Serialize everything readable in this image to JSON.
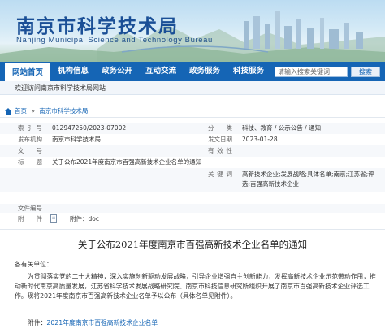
{
  "header": {
    "title_cn": "南京市科学技术局",
    "title_en": "Nanjing Municipal Science and Technology Bureau"
  },
  "nav": {
    "items": [
      "网站首页",
      "机构信息",
      "政务公开",
      "互动交流",
      "政务服务",
      "科技服务"
    ],
    "search_placeholder": "请输入搜索关键词",
    "search_button": "搜索"
  },
  "welcome": "欢迎访问南京市科学技术局网站",
  "breadcrumb": {
    "home": "首页",
    "sep": "»",
    "current": "南京市科学技术局"
  },
  "info": {
    "index_label": "索引号",
    "index_value": "012947250/2023-07002",
    "category_label": "分类",
    "category_value": "科技、教育 / 公示公告 / 通知",
    "publisher_label": "发布机构",
    "publisher_value": "南京市科学技术局",
    "date_label": "发文日期",
    "date_value": "2023-01-28",
    "docno_label": "文号",
    "docno_value": "",
    "validity_label": "有效性",
    "validity_value": "",
    "title_label": "标题",
    "title_value": "关于公布2021年度南京市百强高新技术企业名单的通知",
    "keywords_label": "关键词",
    "keywords_value": "高新技术企业;发展战略;具体名单;南京;江苏省;评选;百强高新技术企业",
    "pubno_label": "文件编号",
    "pubno_value": "",
    "attach_label": "附件",
    "attach_value": "附件：doc"
  },
  "doc": {
    "title": "关于公布2021年度南京市百强高新技术企业名单的通知",
    "salutation": "各有关单位：",
    "para1": "为贯彻落实党的二十大精神，深入实施创新驱动发展战略，引导企业增强自主创新能力，发挥高新技术企业示范带动作用，推动新时代南京高质量发展，江苏省科学技术发展战略研究院、南京市科技信息研究所组织开展了南京市百强高新技术企业评选工作。现将2021年度南京市百强高新技术企业名单予以公布（具体名单见附件）。",
    "attach_prefix": "附件：",
    "attach_link": "2021年度南京市百强高新技术企业名单"
  }
}
